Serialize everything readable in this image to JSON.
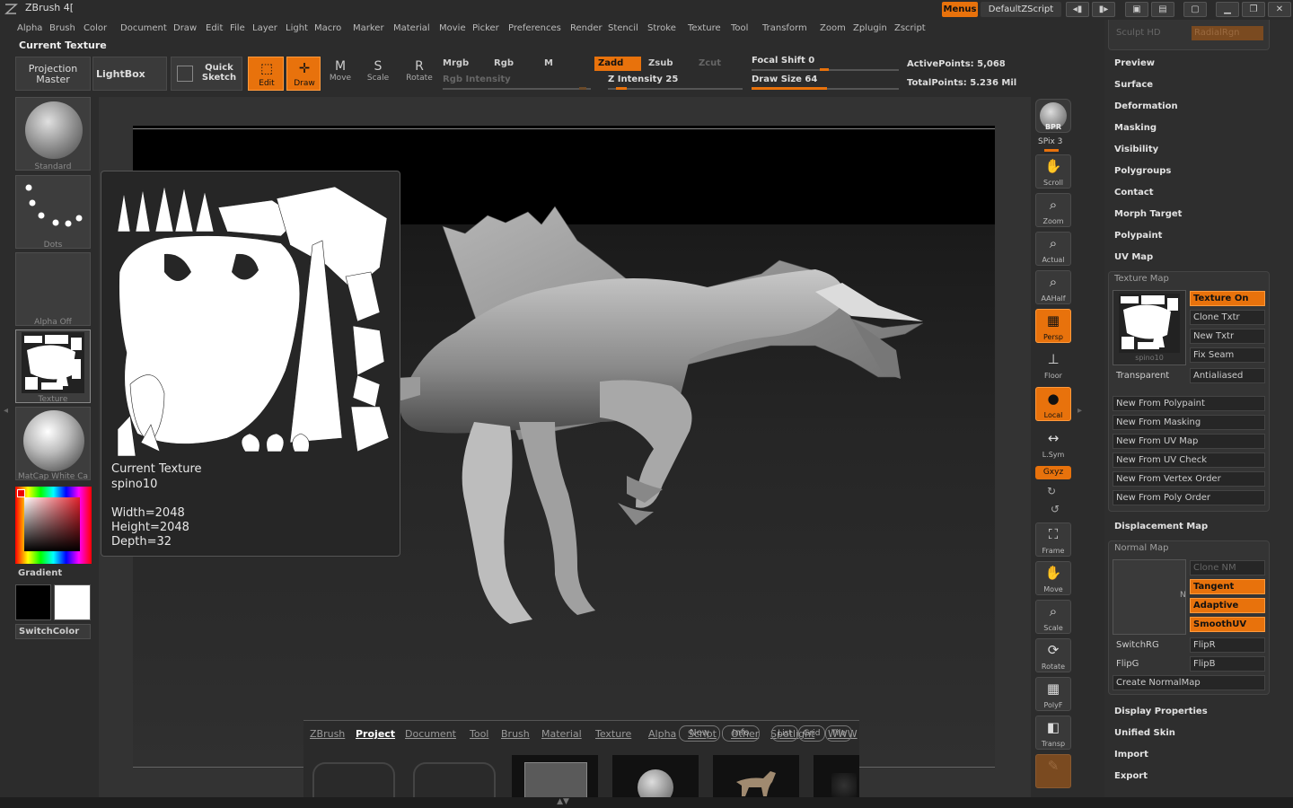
{
  "app": {
    "title": "ZBrush 4[",
    "menus_label": "Menus",
    "script_label": "DefaultZScript"
  },
  "menu": [
    "Alpha",
    "Brush",
    "Color",
    "Document",
    "Draw",
    "Edit",
    "File",
    "Layer",
    "Light",
    "Macro",
    "Marker",
    "Material",
    "Movie",
    "Picker",
    "Preferences",
    "Render",
    "Stencil",
    "Stroke",
    "Texture",
    "Tool",
    "Transform",
    "Zoom",
    "Zplugin",
    "Zscript"
  ],
  "palette_heading": "Current Texture",
  "shelf": {
    "projection_master": "Projection Master",
    "lightbox": "LightBox",
    "quick_sketch": "Quick Sketch",
    "edit": "Edit",
    "draw": "Draw",
    "move": "Move",
    "scale": "Scale",
    "rotate": "Rotate",
    "move_glyph": "M",
    "scale_glyph": "S",
    "rotate_glyph": "R",
    "mrgb": "Mrgb",
    "rgb": "Rgb",
    "m": "M",
    "zadd": "Zadd",
    "zsub": "Zsub",
    "zcut": "Zcut",
    "rgb_intensity": "Rgb Intensity",
    "z_intensity_label": "Z Intensity",
    "z_intensity": "25",
    "z_intensity_fraction": 0.25,
    "focal_shift_label": "Focal Shift",
    "focal_shift": "0",
    "draw_size_label": "Draw Size",
    "draw_size": "64",
    "active_points": "ActivePoints: 5,068",
    "total_points": "TotalPoints: 5.236 Mil"
  },
  "left_tray": {
    "brush": "Standard",
    "stroke": "Dots",
    "alpha": "Alpha Off",
    "texture": "Texture",
    "material": "MatCap White Ca",
    "gradient": "Gradient",
    "switch_color": "SwitchColor"
  },
  "popup": {
    "title": "Current Texture",
    "name": "spino10",
    "width": "Width=2048",
    "height": "Height=2048",
    "depth": "Depth=32"
  },
  "right_shelf": {
    "bpr": "BPR",
    "spix": "SPix 3",
    "scroll": "Scroll",
    "zoom": "Zoom",
    "actual": "Actual",
    "aahalf": "AAHalf",
    "persp": "Persp",
    "floor": "Floor",
    "local": "Local",
    "lsym": "L.Sym",
    "xyz": "Gxyz",
    "frame": "Frame",
    "move": "Move",
    "scale": "Scale",
    "rotate": "Rotate",
    "polyf": "PolyF",
    "transp": "Transp"
  },
  "tool_panel": {
    "top_partial": [
      "Sculpt HD",
      "RadialRgn"
    ],
    "headings": [
      "Preview",
      "Surface",
      "Deformation",
      "Masking",
      "Visibility",
      "Polygroups",
      "Contact",
      "Morph Target",
      "Polypaint",
      "UV Map"
    ],
    "texture_map": {
      "title": "Texture Map",
      "thumb_label": "spino10",
      "texture_on": "Texture On",
      "clone_txtr": "Clone Txtr",
      "new_txtr": "New Txtr",
      "fix_seam": "Fix Seam",
      "transparent": "Transparent",
      "antialiased": "Antialiased",
      "new_from": [
        "New From Polypaint",
        "New From Masking",
        "New From UV Map",
        "New From UV Check",
        "New From Vertex Order",
        "New From Poly Order"
      ]
    },
    "displacement_map": "Displacement Map",
    "normal_map": {
      "title": "Normal Map",
      "clone_nm": "Clone NM",
      "tangent": "Tangent",
      "adaptive": "Adaptive",
      "smoothuv": "SmoothUV",
      "switchrg": "SwitchRG",
      "flipr": "FlipR",
      "flipg": "FlipG",
      "flipb": "FlipB",
      "create": "Create NormalMap",
      "n_label": "N"
    },
    "bottom_headings": [
      "Display Properties",
      "Unified Skin",
      "Import",
      "Export"
    ]
  },
  "browser": {
    "tabs": [
      "ZBrush",
      "Project",
      "Document",
      "Tool",
      "Brush",
      "Material",
      "Texture",
      "Alpha",
      "Script",
      "Other",
      "Spotlight",
      "WWW"
    ],
    "active_tab": "Project",
    "overlay_buttons": [
      "New",
      "Info",
      "List",
      "Grid",
      "Tile"
    ]
  },
  "colors": {
    "accent": "#e8720c",
    "primary_color": "#000000",
    "secondary_color": "#ffffff"
  }
}
